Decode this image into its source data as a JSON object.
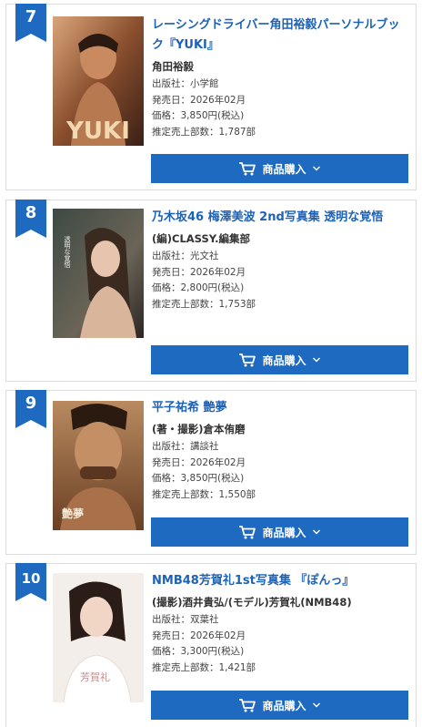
{
  "labels": {
    "publisher": "出版社：",
    "release": "発売日：",
    "price": "価格：",
    "sales": "推定売上部数：",
    "buy": "商品購入"
  },
  "colors": {
    "accent": "#1e6ac0",
    "title": "#1e62b5"
  },
  "items": [
    {
      "rank": "7",
      "title": "レーシングドライバー角田裕毅パーソナルブック『YUKI』",
      "author": "角田裕毅",
      "publisher": "小学館",
      "release": "2026年02月",
      "price": "3,850円(税込)",
      "sales": "1,787部",
      "cover_text": "YUKI"
    },
    {
      "rank": "8",
      "title": "乃木坂46 梅澤美波 2nd写真集 透明な覚悟",
      "author": "(編)CLASSY.編集部",
      "publisher": "光文社",
      "release": "2026年02月",
      "price": "2,800円(税込)",
      "sales": "1,753部",
      "cover_text": "透明な覚悟"
    },
    {
      "rank": "9",
      "title": "平子祐希 艶夢",
      "author": "(著・撮影)倉本侑磨",
      "publisher": "講談社",
      "release": "2026年02月",
      "price": "3,850円(税込)",
      "sales": "1,550部",
      "cover_text": "艶夢"
    },
    {
      "rank": "10",
      "title": "NMB48芳賀礼1st写真集 『ぽんっ』",
      "author": "(撮影)酒井貴弘/(モデル)芳賀礼(NMB48)",
      "publisher": "双葉社",
      "release": "2026年02月",
      "price": "3,300円(税込)",
      "sales": "1,421部",
      "cover_text": "芳賀礼"
    }
  ]
}
